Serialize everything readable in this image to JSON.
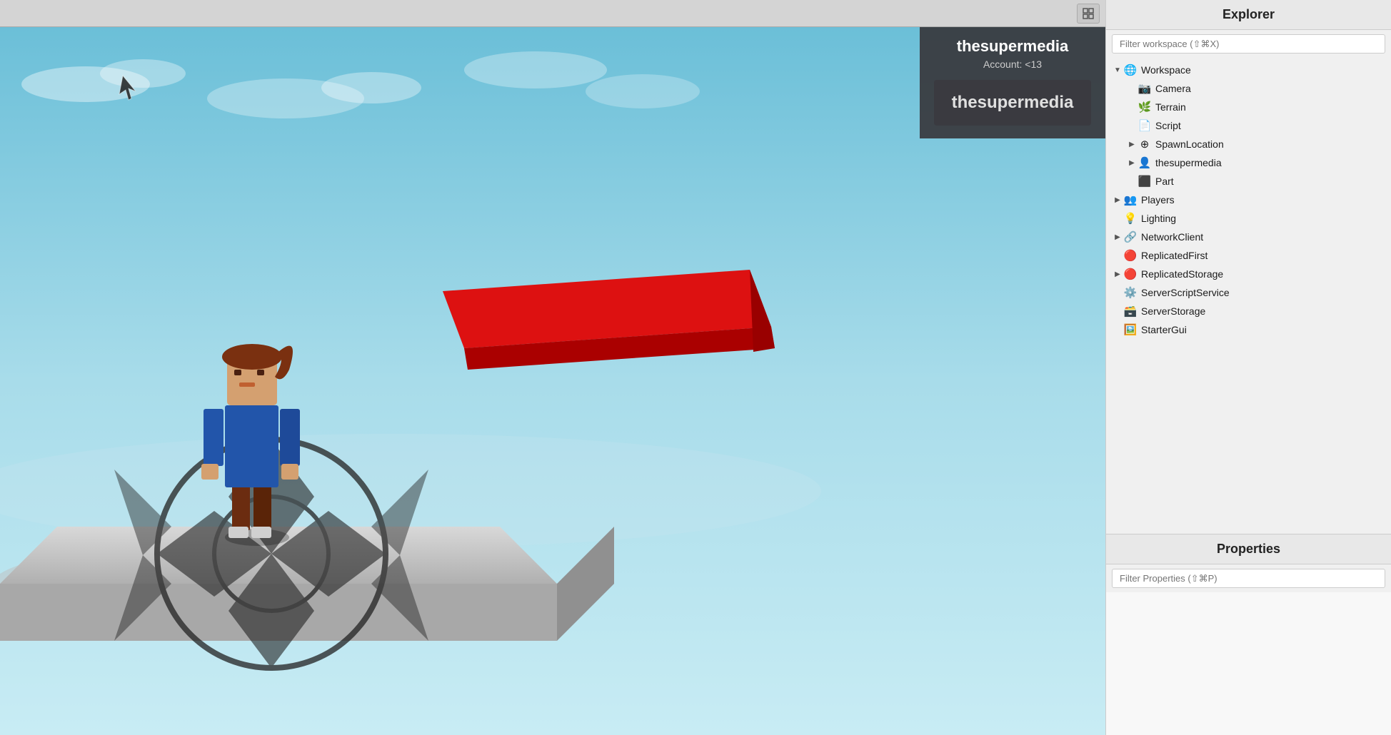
{
  "toolbar": {
    "icon_btn_label": "⊞"
  },
  "user_overlay": {
    "username": "thesupermedia",
    "account_label": "Account: <13",
    "display_name": "thesupermedia"
  },
  "explorer": {
    "title": "Explorer",
    "filter_placeholder": "Filter workspace (⇧⌘X)",
    "tree": [
      {
        "id": "workspace",
        "label": "Workspace",
        "indent": 0,
        "arrow": "expanded",
        "icon": "🌐",
        "icon_class": "icon-globe"
      },
      {
        "id": "camera",
        "label": "Camera",
        "indent": 1,
        "arrow": "empty",
        "icon": "📷",
        "icon_class": "icon-camera"
      },
      {
        "id": "terrain",
        "label": "Terrain",
        "indent": 1,
        "arrow": "empty",
        "icon": "🌿",
        "icon_class": "icon-terrain"
      },
      {
        "id": "script",
        "label": "Script",
        "indent": 1,
        "arrow": "empty",
        "icon": "📄",
        "icon_class": "icon-script"
      },
      {
        "id": "spawnlocation",
        "label": "SpawnLocation",
        "indent": 1,
        "arrow": "collapsed",
        "icon": "⊕",
        "icon_class": "icon-spawn"
      },
      {
        "id": "thesupermedia",
        "label": "thesupermedia",
        "indent": 1,
        "arrow": "collapsed",
        "icon": "👤",
        "icon_class": "icon-user"
      },
      {
        "id": "part",
        "label": "Part",
        "indent": 1,
        "arrow": "empty",
        "icon": "⬜",
        "icon_class": "icon-part"
      },
      {
        "id": "players",
        "label": "Players",
        "indent": 0,
        "arrow": "collapsed",
        "icon": "👥",
        "icon_class": "icon-players"
      },
      {
        "id": "lighting",
        "label": "Lighting",
        "indent": 0,
        "arrow": "empty",
        "icon": "💡",
        "icon_class": "icon-lighting"
      },
      {
        "id": "networkclient",
        "label": "NetworkClient",
        "indent": 0,
        "arrow": "collapsed",
        "icon": "🔗",
        "icon_class": "icon-network"
      },
      {
        "id": "replicatedfirst",
        "label": "ReplicatedFirst",
        "indent": 0,
        "arrow": "empty",
        "icon": "🔴",
        "icon_class": "icon-storage"
      },
      {
        "id": "replicatedstorage",
        "label": "ReplicatedStorage",
        "indent": 0,
        "arrow": "collapsed",
        "icon": "🔴",
        "icon_class": "icon-storage"
      },
      {
        "id": "serverscriptservice",
        "label": "ServerScriptService",
        "indent": 0,
        "arrow": "empty",
        "icon": "⚙️",
        "icon_class": "icon-server"
      },
      {
        "id": "serverstorage",
        "label": "ServerStorage",
        "indent": 0,
        "arrow": "empty",
        "icon": "🗃️",
        "icon_class": "icon-server"
      },
      {
        "id": "startergui",
        "label": "StarterGui",
        "indent": 0,
        "arrow": "empty",
        "icon": "🖼️",
        "icon_class": "icon-starter"
      }
    ]
  },
  "properties": {
    "title": "Properties",
    "filter_placeholder": "Filter Properties (⇧⌘P)"
  }
}
